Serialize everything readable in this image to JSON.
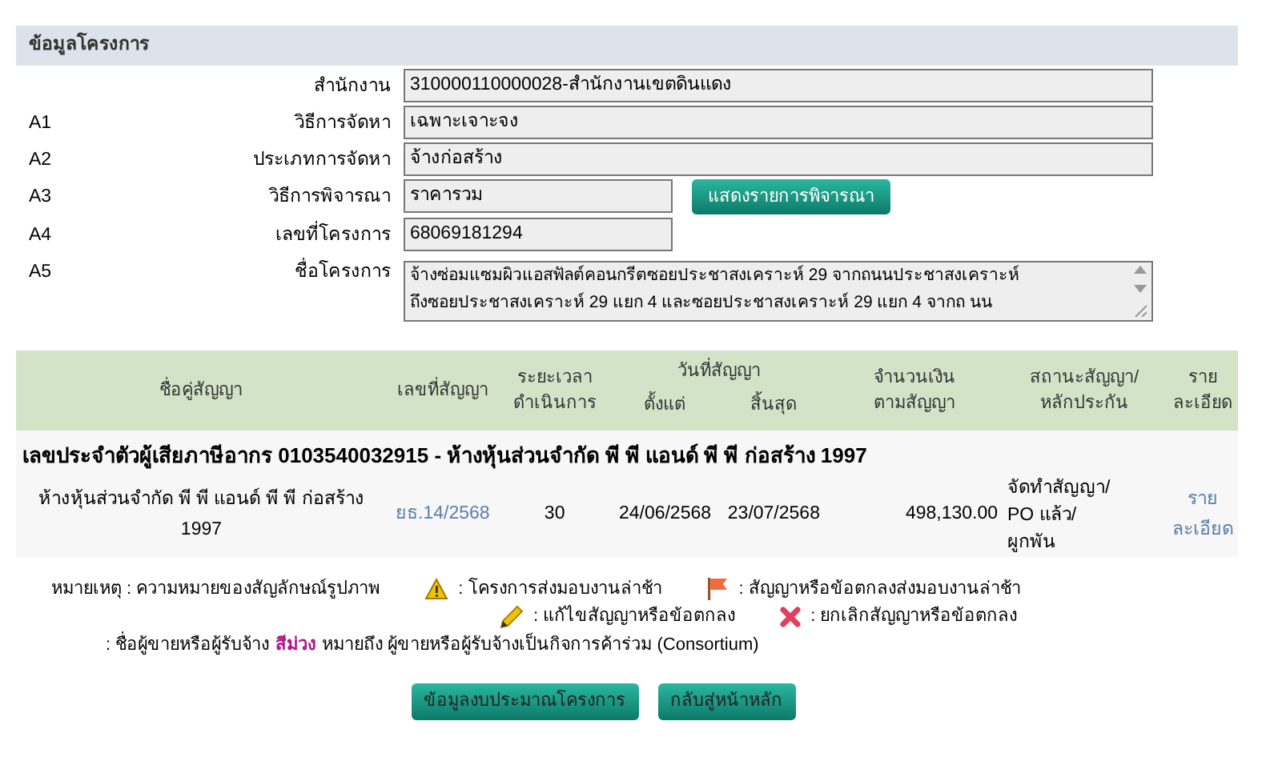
{
  "section_title": "ข้อมูลโครงการ",
  "fields": [
    {
      "label": "สำนักงาน",
      "kind": "wide_input",
      "value": "310000110000028-สำนักงานเขตดินแดง"
    },
    {
      "code": "A1",
      "label": "วิธีการจัดหา",
      "kind": "wide_input",
      "value": "เฉพาะเจาะจง"
    },
    {
      "code": "A2",
      "label": "ประเภทการจัดหา",
      "kind": "wide_input",
      "value": "จ้างก่อสร้าง"
    },
    {
      "code": "A3",
      "label": "วิธีการพิจารณา",
      "kind": "short_input",
      "value": "ราคารวม",
      "button": "แสดงรายการพิจารณา"
    },
    {
      "code": "A4",
      "label": "เลขที่โครงการ",
      "kind": "short_input",
      "value": "68069181294"
    },
    {
      "code": "A5",
      "label": "ชื่อโครงการ",
      "kind": "textarea",
      "lines": [
        "จ้างซ่อมแซมผิวแอสฟัลต์คอนกรีตซอยประชาสงเคราะห์ 29 จากถนนประชาสงเคราะห์",
        "ถึงซอยประชาสงเคราะห์ 29 แยก 4 และซอยประชาสงเคราะห์ 29 แยก 4 จากถ นน"
      ]
    }
  ],
  "table": {
    "columns": [
      {
        "lines": [
          "ชื่อคู่สัญญา"
        ]
      },
      {
        "lines": [
          "เลขที่สัญญา"
        ]
      },
      {
        "lines": [
          "ระยะเวลา",
          "ดำเนินการ"
        ]
      },
      {
        "group": "วันที่สัญญา",
        "sub": [
          "ตั้งแต่",
          "สิ้นสุด"
        ]
      },
      {
        "lines": [
          "จำนวนเงิน",
          "ตามสัญญา"
        ]
      },
      {
        "lines": [
          "สถานะสัญญา/",
          "หลักประกัน"
        ]
      },
      {
        "lines": [
          "ราย",
          "ละเอียด"
        ]
      }
    ],
    "group_row": "เลขประจำตัวผู้เสียภาษีอากร 0103540032915 - ห้างหุ้นส่วนจำกัด พี พี แอนด์ พี พี ก่อสร้าง 1997",
    "rows": [
      {
        "contractor": "ห้างหุ้นส่วนจำกัด พี พี แอนด์ พี พี ก่อสร้าง 1997",
        "contract_no": "ยธ.14/2568",
        "duration": "30",
        "start": "24/06/2568",
        "end": "23/07/2568",
        "amount": "498,130.00",
        "status": "จัดทำสัญญา/ PO แล้ว/ ผูกพัน",
        "detail": "ราย ละเอียด"
      }
    ]
  },
  "legend": {
    "title": "หมายเหตุ : ความหมายของสัญลักษณ์รูปภาพ",
    "items": [
      {
        "kind": "warning",
        "text": ": โครงการส่งมอบงานล่าช้า"
      },
      {
        "kind": "flag",
        "text": ": สัญญาหรือข้อตกลงส่งมอบงานล่าช้า"
      },
      {
        "kind": "pencil",
        "text": ": แก้ไขสัญญาหรือข้อตกลง"
      },
      {
        "kind": "cross",
        "text": ": ยกเลิกสัญญาหรือข้อตกลง"
      }
    ],
    "note": [
      {
        "text": ": ชื่อผู้ขายหรือผู้รับจ้าง",
        "highlight": false
      },
      {
        "text": "สีม่วง",
        "highlight": true
      },
      {
        "text": "หมายถึง ผู้ขายหรือผู้รับจ้างเป็นกิจการค้าร่วม (Consortium)",
        "highlight": false
      }
    ]
  },
  "buttons": [
    "ข้อมูลงบประมาณโครงการ",
    "กลับสู่หน้าหลัก"
  ]
}
